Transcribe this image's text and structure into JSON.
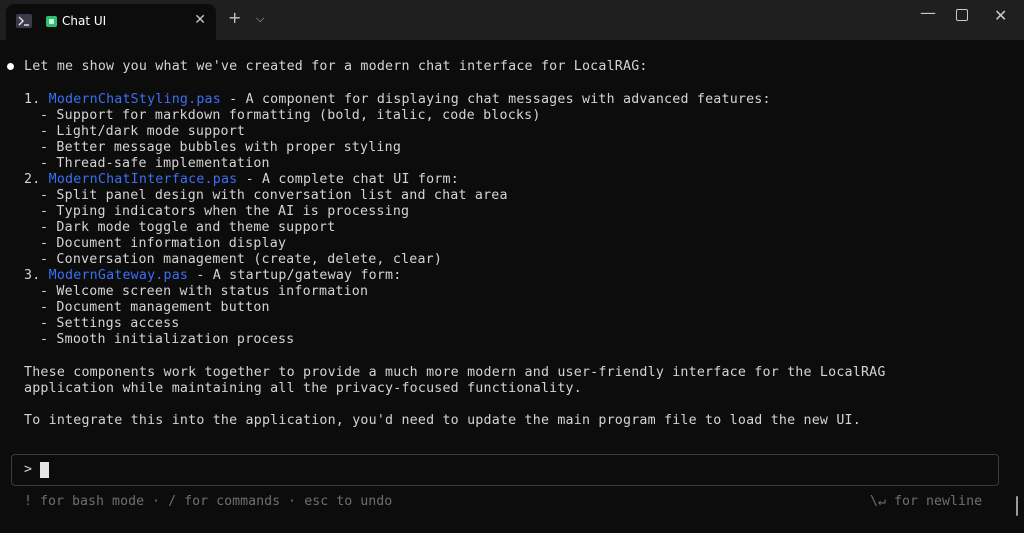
{
  "tab": {
    "title": "Chat UI",
    "close": "✕",
    "new_tab": "+",
    "dropdown": "⌵"
  },
  "window": {
    "minimize": "—",
    "close": "✕"
  },
  "intro": "Let me show you what we've created for a modern chat interface for LocalRAG:",
  "items": [
    {
      "num": "1. ",
      "file": "ModernChatStyling.pas",
      "desc": " - A component for displaying chat messages with advanced features:"
    },
    {
      "num": "2. ",
      "file": "ModernChatInterface.pas",
      "desc": " - A complete chat UI form:"
    },
    {
      "num": "3. ",
      "file": "ModernGateway.pas",
      "desc": " - A startup/gateway form:"
    }
  ],
  "sub1": [
    "- Support for markdown formatting (bold, italic, code blocks)",
    "- Light/dark mode support",
    "- Better message bubbles with proper styling",
    "- Thread-safe implementation"
  ],
  "sub2": [
    "- Split panel design with conversation list and chat area",
    "- Typing indicators when the AI is processing",
    "- Dark mode toggle and theme support",
    "- Document information display",
    "- Conversation management (create, delete, clear)"
  ],
  "sub3": [
    "- Welcome screen with status information",
    "- Document management button",
    "- Settings access",
    "- Smooth initialization process"
  ],
  "para1_line1": "These components work together to provide a much more modern and user-friendly interface for the LocalRAG",
  "para1_line2": "application while maintaining all the privacy-focused functionality.",
  "para2": "To integrate this into the application, you'd need to update the main program file to load the new UI.",
  "input": {
    "prompt": ">"
  },
  "hints": {
    "left": "! for bash mode · / for commands · esc to undo",
    "right": "\\↵ for newline"
  },
  "colors": {
    "file_link": "#3b6ff5",
    "background": "#0c0c0c",
    "text": "#d4d4d4",
    "hint": "#6e6e6e"
  }
}
